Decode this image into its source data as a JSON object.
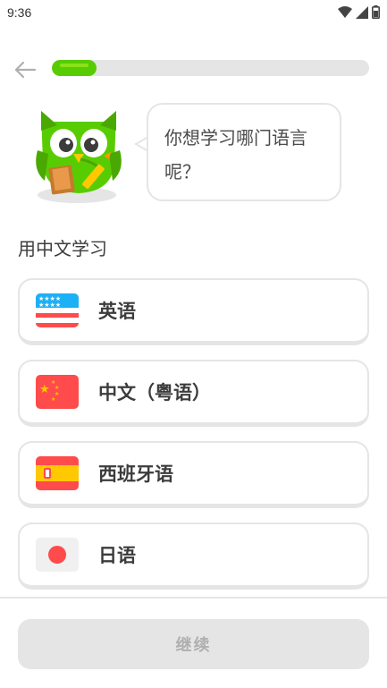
{
  "status_bar": {
    "time": "9:36"
  },
  "progress": {
    "value": 0.14
  },
  "speech": {
    "text": "你想学习哪门语言呢？"
  },
  "section": {
    "title": "用中文学习"
  },
  "languages": [
    {
      "label": "英语",
      "flag": "us-flag-icon"
    },
    {
      "label": "中文（粤语）",
      "flag": "china-flag-icon"
    },
    {
      "label": "西班牙语",
      "flag": "spain-flag-icon"
    },
    {
      "label": "日语",
      "flag": "japan-flag-icon"
    }
  ],
  "footer": {
    "continue_label": "继续"
  },
  "colors": {
    "accent_green": "#58cc02",
    "border": "#e5e5e5",
    "disabled_text": "#afafaf"
  }
}
